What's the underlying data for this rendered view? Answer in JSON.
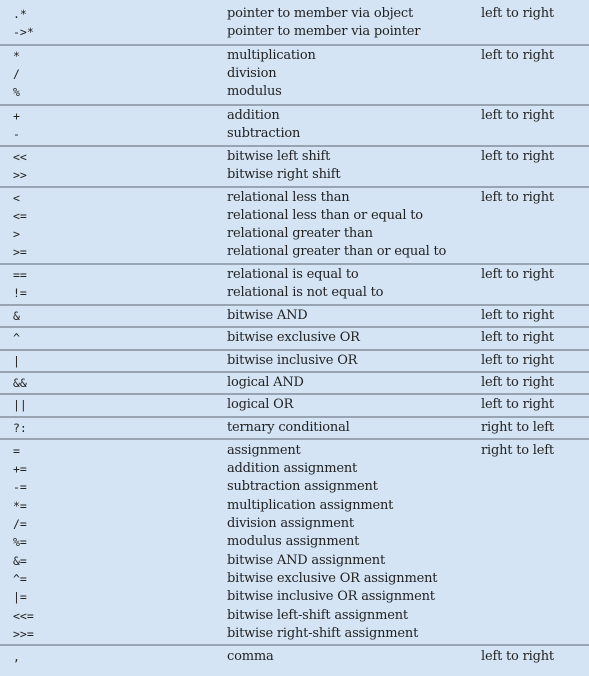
{
  "colors": {
    "background": "#d5e4f4",
    "divider": "#98a4b1",
    "text": "#222222"
  },
  "groups": [
    {
      "associativity": "left to right",
      "rows": [
        {
          "operator": ".*",
          "description": "pointer to member via object"
        },
        {
          "operator": "->*",
          "description": "pointer to member via pointer"
        }
      ]
    },
    {
      "associativity": "left to right",
      "rows": [
        {
          "operator": "*",
          "description": "multiplication"
        },
        {
          "operator": "/",
          "description": "division"
        },
        {
          "operator": "%",
          "description": "modulus"
        }
      ]
    },
    {
      "associativity": "left to right",
      "rows": [
        {
          "operator": "+",
          "description": "addition"
        },
        {
          "operator": "-",
          "description": "subtraction"
        }
      ]
    },
    {
      "associativity": "left to right",
      "rows": [
        {
          "operator": "<<",
          "description": "bitwise left shift"
        },
        {
          "operator": ">>",
          "description": "bitwise right shift"
        }
      ]
    },
    {
      "associativity": "left to right",
      "rows": [
        {
          "operator": "<",
          "description": "relational less than"
        },
        {
          "operator": "<=",
          "description": "relational less than or equal to"
        },
        {
          "operator": ">",
          "description": "relational greater than"
        },
        {
          "operator": ">=",
          "description": "relational greater than or equal to"
        }
      ]
    },
    {
      "associativity": "left to right",
      "rows": [
        {
          "operator": "==",
          "description": "relational is equal to"
        },
        {
          "operator": "!=",
          "description": "relational is not equal to"
        }
      ]
    },
    {
      "associativity": "left to right",
      "rows": [
        {
          "operator": "&",
          "description": "bitwise AND"
        }
      ]
    },
    {
      "associativity": "left to right",
      "rows": [
        {
          "operator": "^",
          "description": "bitwise exclusive OR"
        }
      ]
    },
    {
      "associativity": "left to right",
      "rows": [
        {
          "operator": "|",
          "description": "bitwise inclusive OR"
        }
      ]
    },
    {
      "associativity": "left to right",
      "rows": [
        {
          "operator": "&&",
          "description": "logical AND"
        }
      ]
    },
    {
      "associativity": "left to right",
      "rows": [
        {
          "operator": "||",
          "description": "logical OR"
        }
      ]
    },
    {
      "associativity": "right to left",
      "rows": [
        {
          "operator": "?:",
          "description": "ternary conditional"
        }
      ]
    },
    {
      "associativity": "right to left",
      "rows": [
        {
          "operator": "=",
          "description": "assignment"
        },
        {
          "operator": "+=",
          "description": "addition assignment"
        },
        {
          "operator": "-=",
          "description": "subtraction assignment"
        },
        {
          "operator": "*=",
          "description": "multiplication assignment"
        },
        {
          "operator": "/=",
          "description": "division assignment"
        },
        {
          "operator": "%=",
          "description": "modulus assignment"
        },
        {
          "operator": "&=",
          "description": "bitwise AND assignment"
        },
        {
          "operator": "^=",
          "description": "bitwise exclusive OR assignment"
        },
        {
          "operator": "|=",
          "description": "bitwise inclusive OR assignment"
        },
        {
          "operator": "<<=",
          "description": "bitwise left-shift assignment"
        },
        {
          "operator": ">>=",
          "description": "bitwise right-shift assignment"
        }
      ]
    },
    {
      "associativity": "left to right",
      "rows": [
        {
          "operator": ",",
          "description": "comma"
        }
      ]
    }
  ]
}
